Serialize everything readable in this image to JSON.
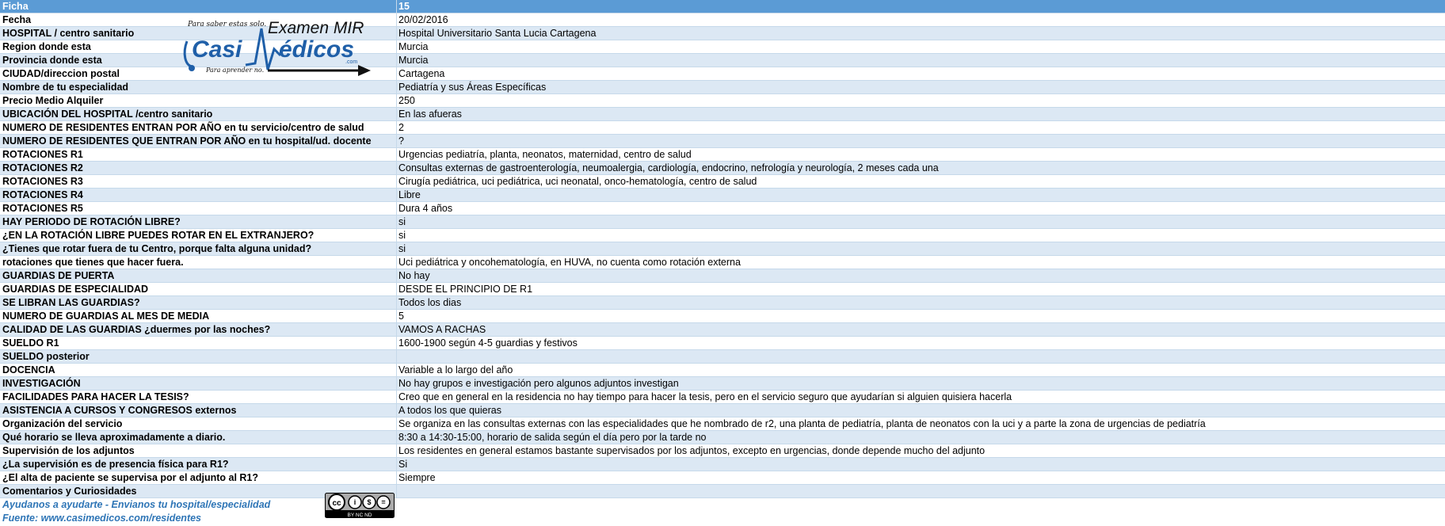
{
  "header": {
    "label": "Ficha",
    "value": "15"
  },
  "rows": [
    {
      "label": "Fecha",
      "value": "20/02/2016"
    },
    {
      "label": "HOSPITAL / centro sanitario",
      "value": "Hospital Universitario Santa Lucia Cartagena"
    },
    {
      "label": "Region donde esta",
      "value": "Murcia"
    },
    {
      "label": "Provincia donde esta",
      "value": "Murcia"
    },
    {
      "label": "CIUDAD/direccion postal",
      "value": "Cartagena"
    },
    {
      "label": "Nombre de tu especialidad",
      "value": "Pediatría y sus Áreas Específicas"
    },
    {
      "label": "Precio Medio Alquiler",
      "value": "250"
    },
    {
      "label": "UBICACIÓN DEL HOSPITAL /centro sanitario",
      "value": "En las afueras"
    },
    {
      "label": "NUMERO DE RESIDENTES ENTRAN POR AÑO en tu servicio/centro de salud",
      "value": "2"
    },
    {
      "label": "NUMERO DE RESIDENTES QUE ENTRAN POR AÑO en tu hospital/ud. docente",
      "value": "?"
    },
    {
      "label": "ROTACIONES R1",
      "value": "Urgencias pediatría, planta, neonatos, maternidad, centro de salud"
    },
    {
      "label": "ROTACIONES R2",
      "value": "Consultas externas de gastroenterología, neumoalergia, cardiología, endocrino, nefrología y neurología, 2 meses cada una"
    },
    {
      "label": "ROTACIONES R3",
      "value": "Cirugía pediátrica, uci pediátrica, uci neonatal, onco-hematología, centro de salud"
    },
    {
      "label": "ROTACIONES R4",
      "value": "Libre"
    },
    {
      "label": "ROTACIONES R5",
      "value": "Dura 4 años"
    },
    {
      "label": "HAY PERIODO DE ROTACIÓN LIBRE?",
      "value": "si"
    },
    {
      "label": "¿EN LA ROTACIÓN LIBRE PUEDES ROTAR EN EL EXTRANJERO?",
      "value": "si"
    },
    {
      "label": "¿Tienes que rotar fuera de tu Centro, porque falta alguna unidad?",
      "value": "si"
    },
    {
      "label": "rotaciones que tienes que hacer fuera.",
      "value": "Uci pediátrica y oncohematología, en HUVA, no cuenta como rotación externa"
    },
    {
      "label": "GUARDIAS DE PUERTA",
      "value": "No hay"
    },
    {
      "label": "GUARDIAS DE ESPECIALIDAD",
      "value": "DESDE EL PRINCIPIO DE R1"
    },
    {
      "label": "SE LIBRAN LAS GUARDIAS?",
      "value": "Todos los dias"
    },
    {
      "label": "NUMERO DE GUARDIAS AL MES DE MEDIA",
      "value": "5"
    },
    {
      "label": "CALIDAD DE LAS GUARDIAS ¿duermes por las noches?",
      "value": "VAMOS A RACHAS"
    },
    {
      "label": "SUELDO R1",
      "value": "1600-1900 según 4-5 guardias y festivos"
    },
    {
      "label": "SUELDO posterior",
      "value": ""
    },
    {
      "label": "DOCENCIA",
      "value": "Variable a lo largo del año"
    },
    {
      "label": "INVESTIGACIÓN",
      "value": "No hay grupos e investigación pero algunos adjuntos investigan"
    },
    {
      "label": "FACILIDADES PARA HACER LA TESIS?",
      "value": "Creo que en general en la residencia no hay tiempo para hacer la tesis, pero en el servicio seguro que ayudarían si alguien quisiera hacerla"
    },
    {
      "label": "ASISTENCIA A CURSOS Y CONGRESOS externos",
      "value": "A todos los que quieras"
    },
    {
      "label": "Organización del servicio",
      "value": "Se organiza en las consultas externas con las especialidades que he nombrado de r2, una planta de pediatría, planta de neonatos con la uci y a parte la zona de urgencias de pediatría"
    },
    {
      "label": "Qué horario se lleva aproximadamente a diario.",
      "value": "8:30 a 14:30-15:00, horario de salida según el día pero por la tarde no"
    },
    {
      "label": "Supervisión de los adjuntos",
      "value": "Los residentes en general estamos bastante supervisados por los adjuntos, excepto en urgencias, donde depende mucho del adjunto"
    },
    {
      "label": "¿La supervisión es de presencia física para R1?",
      "value": "Si"
    },
    {
      "label": "¿El alta de paciente se supervisa por el adjunto al R1?",
      "value": "Siempre"
    },
    {
      "label": "Comentarios y Curiosidades",
      "value": ""
    }
  ],
  "footer": {
    "line1": "Ayudanos a ayudarte - Envianos tu hospital/especialidad",
    "line2": "Fuente: www.casimedicos.com/residentes"
  },
  "logo": {
    "tagline_top": "Para saber estas solo.",
    "exam": "Examen MIR",
    "brand_left": "Casi",
    "brand_right": "édicos",
    "dotcom": ".com",
    "tagline_bottom": "Para aprender no."
  },
  "license": {
    "text": "BY  NC  ND"
  },
  "colors": {
    "header": "#5b9bd5",
    "alt_row": "#dce8f4",
    "footer_text": "#2e75b6",
    "logo_blue": "#1f5fa8"
  }
}
